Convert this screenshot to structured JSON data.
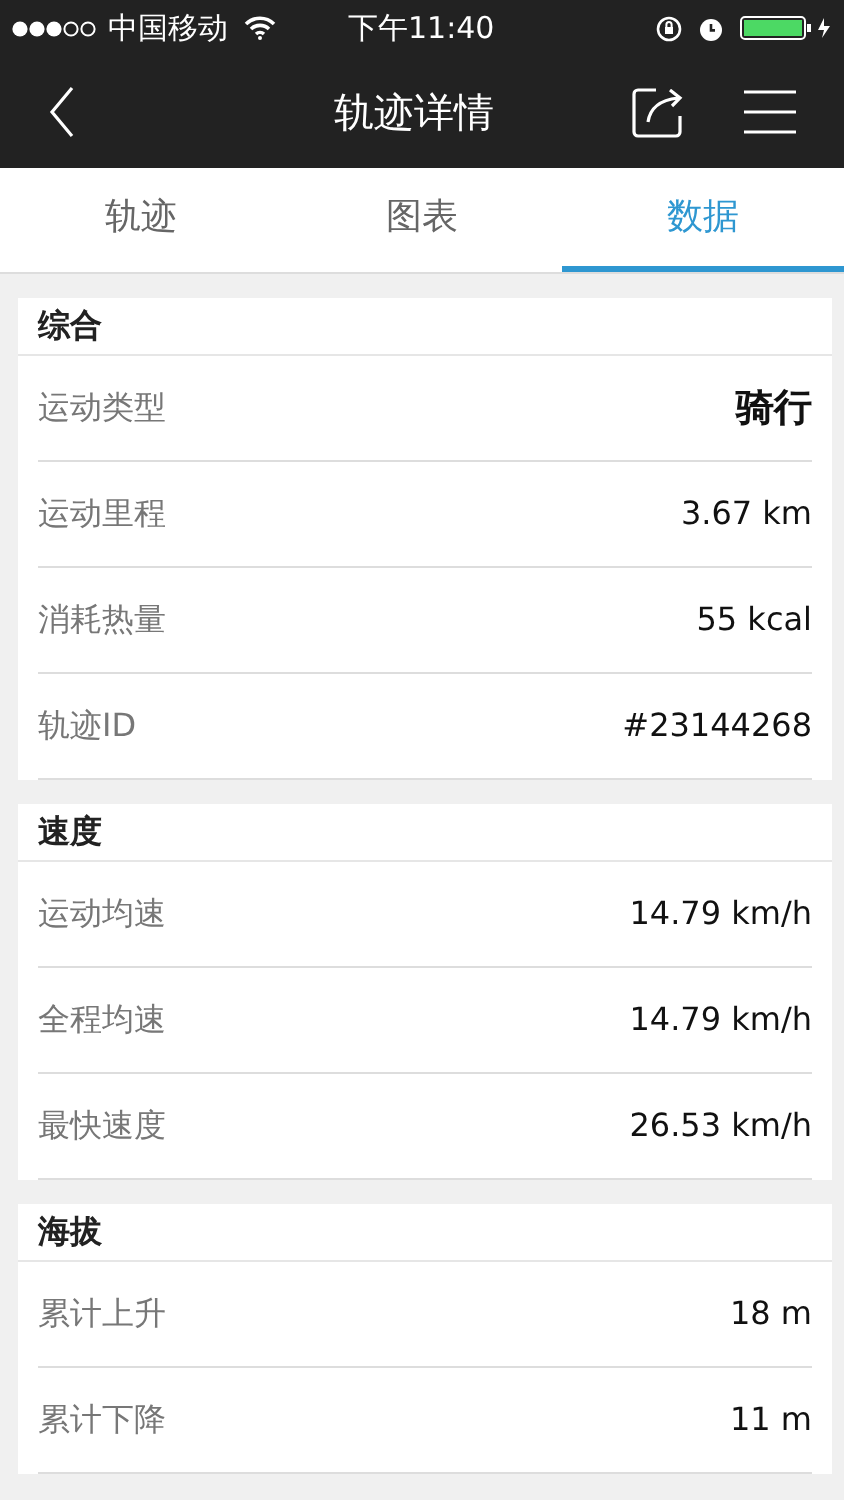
{
  "status_bar": {
    "carrier": "中国移动",
    "time": "下午11:40"
  },
  "header": {
    "title": "轨迹详情"
  },
  "tabs": [
    {
      "label": "轨迹",
      "selected": false
    },
    {
      "label": "图表",
      "selected": false
    },
    {
      "label": "数据",
      "selected": true
    }
  ],
  "sections": [
    {
      "title": "综合",
      "rows": [
        {
          "label": "运动类型",
          "value": "骑行",
          "emphasized": true
        },
        {
          "label": "运动里程",
          "value": "3.67 km",
          "emphasized": false
        },
        {
          "label": "消耗热量",
          "value": "55 kcal",
          "emphasized": false
        },
        {
          "label": "轨迹ID",
          "value": "#23144268",
          "emphasized": false
        }
      ]
    },
    {
      "title": "速度",
      "rows": [
        {
          "label": "运动均速",
          "value": "14.79 km/h",
          "emphasized": false
        },
        {
          "label": "全程均速",
          "value": "14.79 km/h",
          "emphasized": false
        },
        {
          "label": "最快速度",
          "value": "26.53 km/h",
          "emphasized": false
        }
      ]
    },
    {
      "title": "海拔",
      "rows": [
        {
          "label": "累计上升",
          "value": "18 m",
          "emphasized": false
        },
        {
          "label": "累计下降",
          "value": "11 m",
          "emphasized": false
        }
      ]
    }
  ]
}
